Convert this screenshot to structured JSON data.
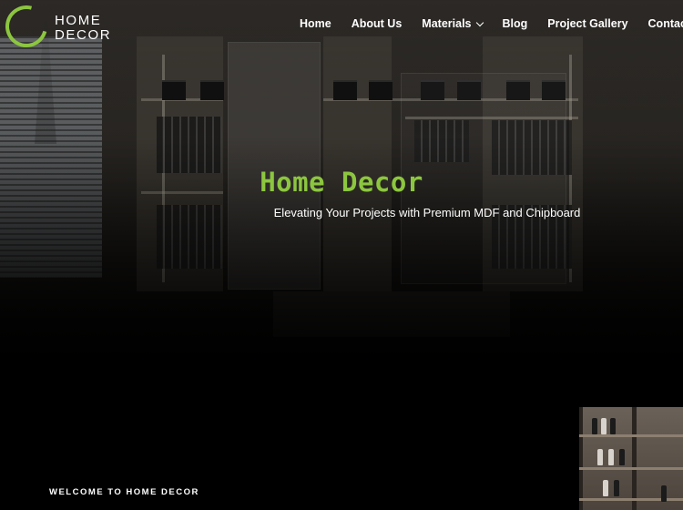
{
  "brand": {
    "line1": "HOME",
    "line2": "DECOR",
    "accent": "#8cc63f"
  },
  "nav": [
    {
      "label": "Home"
    },
    {
      "label": "About Us"
    },
    {
      "label": "Materials",
      "has_dropdown": true
    },
    {
      "label": "Blog"
    },
    {
      "label": "Project Gallery"
    },
    {
      "label": "Contact Us"
    }
  ],
  "hero": {
    "title": "Home Decor",
    "subtitle": "Elevating Your Projects with Premium MDF and Chipboard"
  },
  "intro": {
    "eyebrow": "WELCOME TO HOME DECOR"
  },
  "icons": {
    "dropdown": "chevron-down-icon",
    "logo": "logo-ring-icon"
  },
  "colors": {
    "background": "#000000",
    "accent": "#8cc63f",
    "text": "#ffffff"
  }
}
